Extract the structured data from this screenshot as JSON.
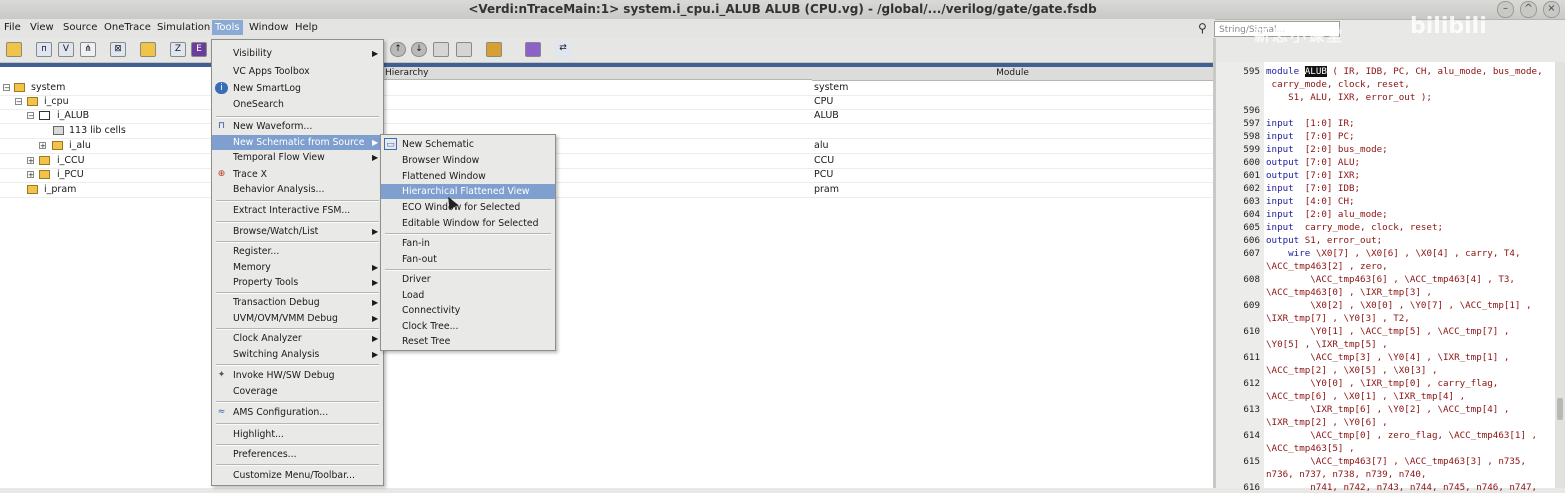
{
  "window": {
    "title": "<Verdi:nTraceMain:1> system.i_cpu.i_ALUB ALUB (CPU.vg) - /global/.../verilog/gate/gate.fsdb"
  },
  "menubar": {
    "items": [
      "File",
      "View",
      "Source",
      "OneTrace",
      "Simulation",
      "Tools",
      "Window",
      "Help"
    ],
    "active": "Tools"
  },
  "search": {
    "placeholder": "String/Signal..."
  },
  "watermark": {
    "text": "新思小课堂",
    "logo": "bilibili"
  },
  "hierarchy": {
    "col_hierarchy": "Hierarchy",
    "col_module": "Module",
    "rows": [
      {
        "label": "system",
        "module": "system",
        "icon": "folder-icon"
      },
      {
        "label": "i_cpu",
        "module": "CPU",
        "icon": "folder-icon"
      },
      {
        "label": "i_ALUB",
        "module": "ALUB",
        "icon": "gate-icon"
      },
      {
        "label": "113 lib cells",
        "module": "",
        "icon": "cells-icon"
      },
      {
        "label": "i_alu",
        "module": "alu",
        "icon": "folder-icon"
      },
      {
        "label": "i_CCU",
        "module": "CCU",
        "icon": "folder-icon"
      },
      {
        "label": "i_PCU",
        "module": "PCU",
        "icon": "folder-icon"
      },
      {
        "label": "i_pram",
        "module": "pram",
        "icon": "folder-icon"
      }
    ]
  },
  "tools_menu": {
    "items": [
      {
        "label": "Visibility",
        "submenu": true
      },
      {
        "label": "VC Apps Toolbox"
      },
      {
        "label": "New SmartLog",
        "icon": "log-icon"
      },
      {
        "label": "OneSearch"
      },
      {
        "label": "New Waveform...",
        "icon": "waveform-icon"
      },
      {
        "label": "New Schematic from Source",
        "submenu": true
      },
      {
        "label": "Temporal Flow View",
        "submenu": true
      },
      {
        "label": "Trace X",
        "icon": "trace-icon"
      },
      {
        "label": "Behavior Analysis..."
      },
      {
        "label": "Extract Interactive FSM..."
      },
      {
        "label": "Browse/Watch/List",
        "submenu": true
      },
      {
        "label": "Register..."
      },
      {
        "label": "Memory",
        "submenu": true
      },
      {
        "label": "Property Tools",
        "submenu": true
      },
      {
        "label": "Transaction Debug",
        "submenu": true
      },
      {
        "label": "UVM/OVM/VMM Debug",
        "submenu": true
      },
      {
        "label": "Clock Analyzer",
        "submenu": true
      },
      {
        "label": "Switching Analysis",
        "submenu": true
      },
      {
        "label": "Invoke HW/SW Debug",
        "icon": "hwsw-icon"
      },
      {
        "label": "Coverage"
      },
      {
        "label": "AMS Configuration...",
        "icon": "ams-icon"
      },
      {
        "label": "Highlight..."
      },
      {
        "label": "Preferences..."
      },
      {
        "label": "Customize Menu/Toolbar..."
      }
    ]
  },
  "schematic_submenu": {
    "items": [
      {
        "label": "New Schematic",
        "icon": "schematic-icon"
      },
      {
        "label": "Browser Window"
      },
      {
        "label": "Flattened Window"
      },
      {
        "label": "Hierarchical Flattened View"
      },
      {
        "label": "ECO Window for Selected"
      },
      {
        "label": "Editable Window for Selected"
      },
      {
        "label": "Fan-in"
      },
      {
        "label": "Fan-out"
      },
      {
        "label": "Driver"
      },
      {
        "label": "Load"
      },
      {
        "label": "Connectivity"
      },
      {
        "label": "Clock Tree..."
      },
      {
        "label": "Reset Tree"
      }
    ],
    "highlighted": "Hierarchical Flattened View"
  },
  "source": {
    "lines": [
      {
        "num": "595",
        "text": "module ",
        "hl": "ALUB",
        "rest": " ( IR, IDB, PC, CH, alu_mode, bus_mode,"
      },
      {
        "num": "",
        "text": " carry_mode, clock, reset,"
      },
      {
        "num": "",
        "text": "    S1, ALU, IXR, error_out );"
      },
      {
        "num": "596",
        "text": ""
      },
      {
        "num": "597",
        "text": "input  [1:0] IR;"
      },
      {
        "num": "598",
        "text": "input  [7:0] PC;"
      },
      {
        "num": "599",
        "text": "input  [2:0] bus_mode;"
      },
      {
        "num": "600",
        "text": "output [7:0] ALU;"
      },
      {
        "num": "601",
        "text": "output [7:0] IXR;"
      },
      {
        "num": "602",
        "text": "input  [7:0] IDB;"
      },
      {
        "num": "603",
        "text": "input  [4:0] CH;"
      },
      {
        "num": "604",
        "text": "input  [2:0] alu_mode;"
      },
      {
        "num": "605",
        "text": "input  carry_mode, clock, reset;"
      },
      {
        "num": "606",
        "text": "output S1, error_out;"
      },
      {
        "num": "607",
        "text": "    wire \\X0[7] , \\X0[6] , \\X0[4] , carry, T4,"
      },
      {
        "num": "",
        "text": "\\ACC_tmp463[2] , zero,"
      },
      {
        "num": "608",
        "text": "        \\ACC_tmp463[6] , \\ACC_tmp463[4] , T3,"
      },
      {
        "num": "",
        "text": "\\ACC_tmp463[0] , \\IXR_tmp[3] ,"
      },
      {
        "num": "609",
        "text": "        \\X0[2] , \\X0[0] , \\Y0[7] , \\ACC_tmp[1] ,"
      },
      {
        "num": "",
        "text": "\\IXR_tmp[7] , \\Y0[3] , T2,"
      },
      {
        "num": "610",
        "text": "        \\Y0[1] , \\ACC_tmp[5] , \\ACC_tmp[7] ,"
      },
      {
        "num": "",
        "text": "\\Y0[5] , \\IXR_tmp[5] ,"
      },
      {
        "num": "611",
        "text": "        \\ACC_tmp[3] , \\Y0[4] , \\IXR_tmp[1] ,"
      },
      {
        "num": "",
        "text": "\\ACC_tmp[2] , \\X0[5] , \\X0[3] ,"
      },
      {
        "num": "612",
        "text": "        \\Y0[0] , \\IXR_tmp[0] , carry_flag,"
      },
      {
        "num": "",
        "text": "\\ACC_tmp[6] , \\X0[1] , \\IXR_tmp[4] ,"
      },
      {
        "num": "613",
        "text": "        \\IXR_tmp[6] , \\Y0[2] , \\ACC_tmp[4] ,"
      },
      {
        "num": "",
        "text": "\\IXR_tmp[2] , \\Y0[6] ,"
      },
      {
        "num": "614",
        "text": "        \\ACC_tmp[0] , zero_flag, \\ACC_tmp463[1] ,"
      },
      {
        "num": "",
        "text": "\\ACC_tmp463[5] ,"
      },
      {
        "num": "615",
        "text": "        \\ACC_tmp463[7] , \\ACC_tmp463[3] , n735,"
      },
      {
        "num": "",
        "text": "n736, n737, n738, n739, n740,"
      },
      {
        "num": "616",
        "text": "        n741, n742, n743, n744, n745, n746, n747,"
      }
    ]
  },
  "colors": {
    "accent": "#7f9fce",
    "code": "#8c1212",
    "keyword": "#1c1ca0",
    "tree_strip": "#3f5f95"
  }
}
